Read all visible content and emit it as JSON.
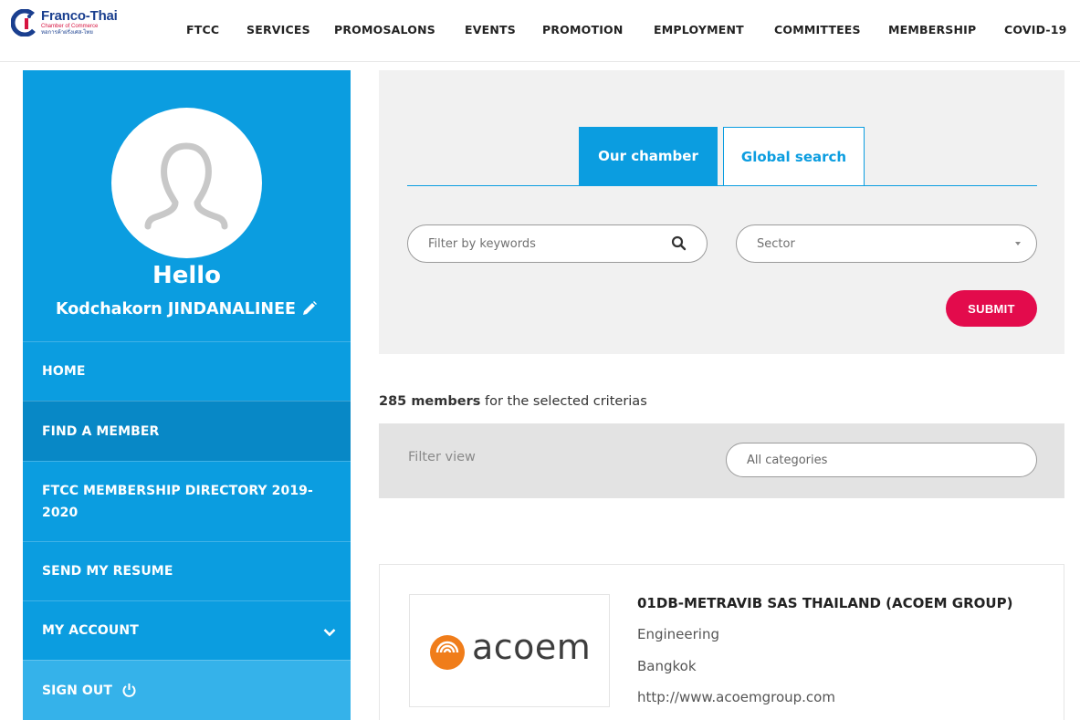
{
  "brand": {
    "name": "Franco-Thai",
    "subtitle": "Chamber of Commerce",
    "subtitle_thai": "หอการค้าฝรั่งเศส-ไทย"
  },
  "nav": {
    "items": [
      "FTCC",
      "SERVICES",
      "PROMOSALONS",
      "EVENTS",
      "PROMOTION",
      "EMPLOYMENT",
      "COMMITTEES",
      "MEMBERSHIP",
      "COVID-19"
    ]
  },
  "sidebar": {
    "greeting": "Hello",
    "user_name": "Kodchakorn JINDANALINEE",
    "menu": [
      {
        "label": "HOME"
      },
      {
        "label": "FIND A MEMBER"
      },
      {
        "label": "FTCC MEMBERSHIP DIRECTORY 2019-2020"
      },
      {
        "label": "SEND MY RESUME"
      },
      {
        "label": "MY ACCOUNT"
      },
      {
        "label": "SIGN OUT"
      }
    ]
  },
  "search": {
    "tabs": [
      "Our chamber",
      "Global search"
    ],
    "keyword_placeholder": "Filter by keywords",
    "sector_placeholder": "Sector",
    "submit_label": "SUBMIT"
  },
  "results": {
    "count": "285 members",
    "count_suffix": " for the selected criterias",
    "filter_label": "Filter view",
    "filter_value": "All categories"
  },
  "member": {
    "logo_text": "acoem",
    "name": "01DB-METRAVIB SAS THAILAND (ACOEM GROUP)",
    "sector": "Engineering",
    "city": "Bangkok",
    "website": "http://www.acoemgroup.com"
  },
  "colors": {
    "primary_blue": "#0b9de0",
    "active_blue": "#0888c6",
    "submit_red": "#e30b4c",
    "brand_navy": "#1a3f8f",
    "acoem_orange": "#f07d1a"
  }
}
